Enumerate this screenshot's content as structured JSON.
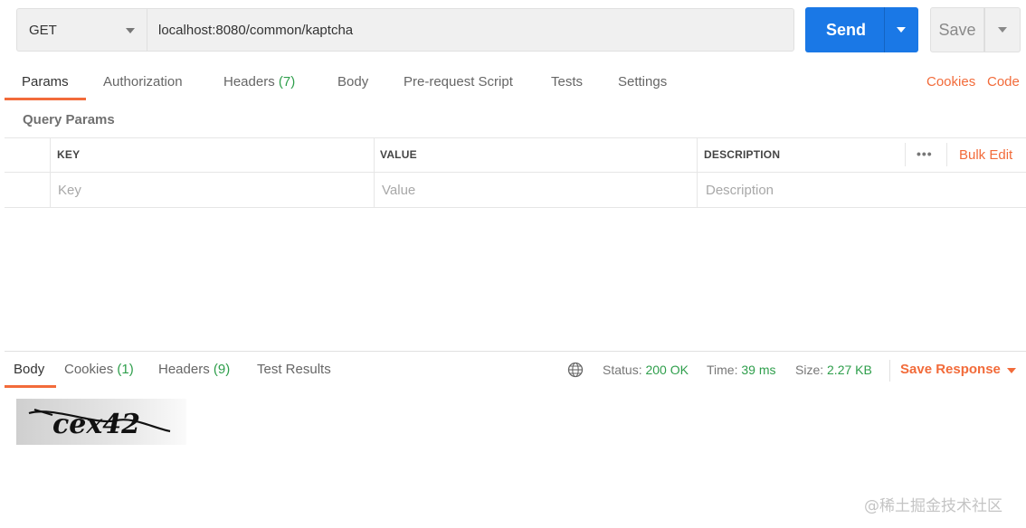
{
  "request": {
    "method": "GET",
    "url": "localhost:8080/common/kaptcha",
    "send_label": "Send",
    "save_label": "Save"
  },
  "request_tabs": {
    "params": "Params",
    "authorization": "Authorization",
    "headers": "Headers",
    "headers_count": "(7)",
    "body": "Body",
    "pre_request": "Pre-request Script",
    "tests": "Tests",
    "settings": "Settings",
    "cookies": "Cookies",
    "code": "Code"
  },
  "query_params": {
    "title": "Query Params",
    "columns": [
      "KEY",
      "VALUE",
      "DESCRIPTION"
    ],
    "placeholders": {
      "key": "Key",
      "value": "Value",
      "description": "Description"
    },
    "more_label": "•••",
    "bulk_edit": "Bulk Edit"
  },
  "response": {
    "tabs": {
      "body": "Body",
      "cookies": "Cookies",
      "cookies_count": "(1)",
      "headers": "Headers",
      "headers_count": "(9)",
      "test_results": "Test Results"
    },
    "status_label": "Status:",
    "status_value": "200 OK",
    "time_label": "Time:",
    "time_value": "39 ms",
    "size_label": "Size:",
    "size_value": "2.27 KB",
    "save_response": "Save Response",
    "captcha_text": "cex42"
  },
  "watermark": "@稀土掘金技术社区",
  "colors": {
    "accent": "#f26b3a",
    "primary": "#1a78e6",
    "success": "#2e9e4b"
  },
  "icons": [
    "chevron-down-icon",
    "globe-icon",
    "more-icon"
  ]
}
